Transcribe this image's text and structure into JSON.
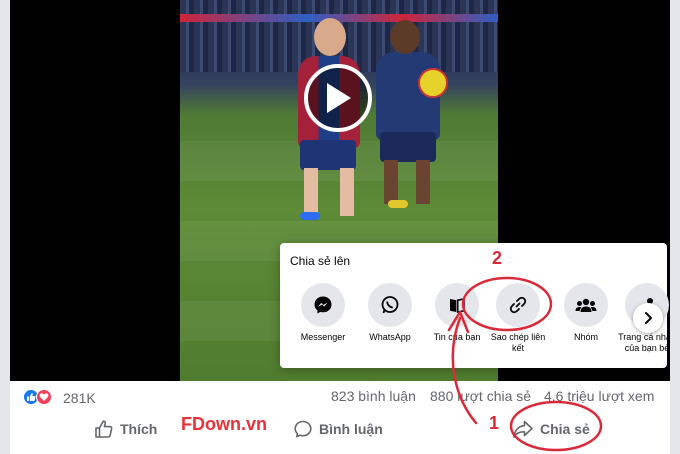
{
  "share_popup": {
    "title": "Chia sẻ lên",
    "items": [
      {
        "label": "Messenger",
        "icon": "messenger-icon"
      },
      {
        "label": "WhatsApp",
        "icon": "whatsapp-icon"
      },
      {
        "label": "Tin của bạn",
        "icon": "story-icon"
      },
      {
        "label": "Sao chép liên kết",
        "icon": "link-icon"
      },
      {
        "label": "Nhóm",
        "icon": "group-icon"
      },
      {
        "label": "Trang cá nhân của bạn bè",
        "icon": "friend-profile-icon"
      }
    ]
  },
  "stats": {
    "reactions": "281K",
    "comments": "823 bình luận",
    "shares": "880 lượt chia sẻ",
    "views": "4,6 triệu lượt xem"
  },
  "actions": {
    "like": "Thích",
    "comment": "Bình luận",
    "share": "Chia sẻ"
  },
  "watermark": "FDown.vn",
  "annotations": {
    "step1": "1",
    "step2": "2",
    "color": "#d92a3a"
  },
  "colors": {
    "facebook_blue": "#1877f2",
    "love_red": "#f33e58",
    "muted_text": "#65676b"
  }
}
